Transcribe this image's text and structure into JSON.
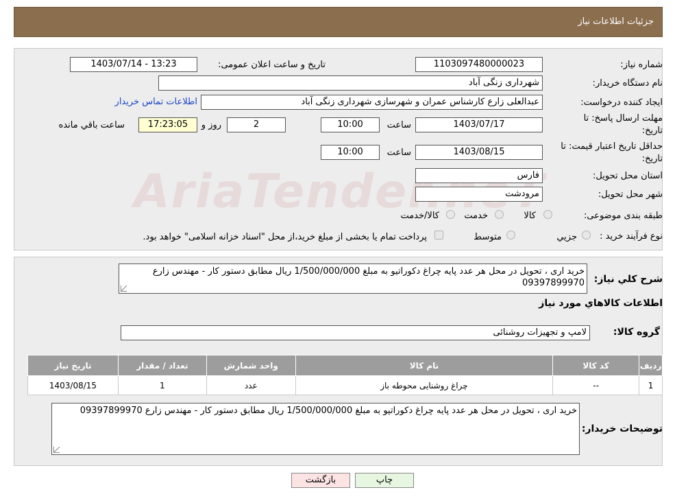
{
  "header": {
    "title": "جزئیات اطلاعات نیاز"
  },
  "form": {
    "need_number_label": "شماره نیاز:",
    "need_number": "1103097480000023",
    "announce_label": "تاریخ و ساعت اعلان عمومی:",
    "announce_value": "1403/07/14 - 13:23",
    "buyer_org_label": "نام دستگاه خریدار:",
    "buyer_org": "شهرداری زنگی آباد",
    "creator_label": "ایجاد کننده درخواست:",
    "creator": "عبدالعلی زارع کارشناس عمران و شهرسازی شهرداری زنگی آباد",
    "contact_link": "اطلاعات تماس خریدار",
    "reply_deadline_label_1": "مهلت ارسال پاسخ: تا",
    "reply_deadline_label_2": "تاریخ:",
    "reply_date": "1403/07/17",
    "time_label": "ساعت",
    "reply_time": "10:00",
    "days_value": "2",
    "days_label": "روز و",
    "remaining_time": "17:23:05",
    "remaining_label": "ساعت باقي مانده",
    "price_validity_label_1": "حداقل تاریخ اعتبار قیمت: تا",
    "price_validity_label_2": "تاریخ:",
    "price_date": "1403/08/15",
    "price_time": "10:00",
    "province_label": "استان محل تحویل:",
    "province": "فارس",
    "city_label": "شهر محل تحویل:",
    "city": "مرودشت",
    "category_label": "طبقه بندی موضوعی:",
    "category_options": [
      "کالا",
      "خدمت",
      "کالا/خدمت"
    ],
    "process_label": "نوع فرآیند خرید :",
    "process_options": [
      "جزیي",
      "متوسط"
    ],
    "process_note": "پرداخت تمام یا بخشی از مبلغ خرید،از محل \"اسناد خزانه اسلامی\" خواهد بود."
  },
  "details": {
    "summary_label": "شرح کلي نیاز:",
    "summary_text": "خرید اری ، تحویل در محل  هر عدد پایه چراغ دکوراتیو  به مبلغ 1/500/000/000 ریال مطابق دستور کار - مهندس زارع 09397899970",
    "goods_info_title": "اطلاعات کالاهاي مورد نیاز",
    "goods_group_label": "گروه کالا:",
    "goods_group": "لامپ و تجهیزات روشنائی",
    "table": {
      "headers": [
        "ردیف",
        "کد کالا",
        "نام کالا",
        "واحد شمارش",
        "تعداد / مقدار",
        "تاریخ نیاز"
      ],
      "rows": [
        [
          "1",
          "--",
          "چراغ روشنایی محوطه باز",
          "عدد",
          "1",
          "1403/08/15"
        ]
      ]
    },
    "buyer_notes_label": "توضیحات خریدار:",
    "buyer_notes": "خرید اری ، تحویل در محل  هر عدد پایه چراغ دکوراتیو  به مبلغ 1/500/000/000 ریال مطابق دستور کار - مهندس زارع 09397899970"
  },
  "buttons": {
    "print": "چاپ",
    "back": "بازگشت"
  },
  "watermark": "AriaTender.neT",
  "colors": {
    "header": "#8B6E4E",
    "panel": "#ededed",
    "yellow_field": "#ffffd2",
    "link": "#1a44c8",
    "back_button": "#fde4e4",
    "print_button": "#e7f6e1"
  }
}
